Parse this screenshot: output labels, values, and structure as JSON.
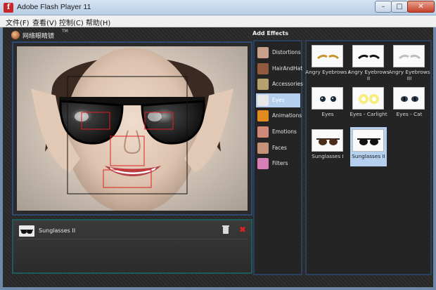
{
  "window": {
    "title": "Adobe Flash Player 11",
    "icon_name": "flash-icon",
    "icon_glyph": "f",
    "min_glyph": "–",
    "max_glyph": "□",
    "close_glyph": "✕"
  },
  "menu": [
    "文件(F)",
    "查看(V)",
    "控制(C)",
    "帮助(H)"
  ],
  "brand": {
    "name": "网络眼睛镜",
    "tm": "TM"
  },
  "add_effects_title": "Add Effects",
  "categories": [
    {
      "label": "Distortions",
      "icon": "distortions-icon",
      "color": "#c9a08a",
      "selected": false
    },
    {
      "label": "HairAndHat",
      "icon": "hair-hat-icon",
      "color": "#8f5a3e",
      "selected": false
    },
    {
      "label": "Accessories",
      "icon": "accessories-icon",
      "color": "#b9a070",
      "selected": false
    },
    {
      "label": "Eyes",
      "icon": "eyes-icon",
      "color": "#e8e8e8",
      "selected": true
    },
    {
      "label": "Animations",
      "icon": "butterfly-icon",
      "color": "#e08a20",
      "selected": false
    },
    {
      "label": "Emotions",
      "icon": "emotions-icon",
      "color": "#d08878",
      "selected": false
    },
    {
      "label": "Faces",
      "icon": "faces-icon",
      "color": "#c49378",
      "selected": false
    },
    {
      "label": "Filters",
      "icon": "filters-icon",
      "color": "#d77fb6",
      "selected": false
    }
  ],
  "effects": [
    {
      "label": "Angry Eyebrows I",
      "icon": "eyebrows-gold-icon",
      "selected": false
    },
    {
      "label": "Angry Eyebrows II",
      "icon": "eyebrows-black-icon",
      "selected": false
    },
    {
      "label": "Angry Eyebrows III",
      "icon": "eyebrows-silver-icon",
      "selected": false
    },
    {
      "label": "Eyes",
      "icon": "eyes-icon",
      "selected": false
    },
    {
      "label": "Eyes - Carlight",
      "icon": "carlight-eyes-icon",
      "selected": false
    },
    {
      "label": "Eyes - Cat",
      "icon": "cat-eyes-icon",
      "selected": false
    },
    {
      "label": "Sunglasses I",
      "icon": "sunglasses-brown-icon",
      "selected": false
    },
    {
      "label": "Sunglasses II",
      "icon": "sunglasses-black-icon",
      "selected": true
    }
  ],
  "applied_effects": [
    {
      "label": "Sunglasses II",
      "icon": "sunglasses-black-icon",
      "remove_glyph": "✖"
    }
  ],
  "colors": {
    "selected_bg": "#b5cfee",
    "panel_border": "#2b4060",
    "tracking_box": "#e01f1f"
  }
}
